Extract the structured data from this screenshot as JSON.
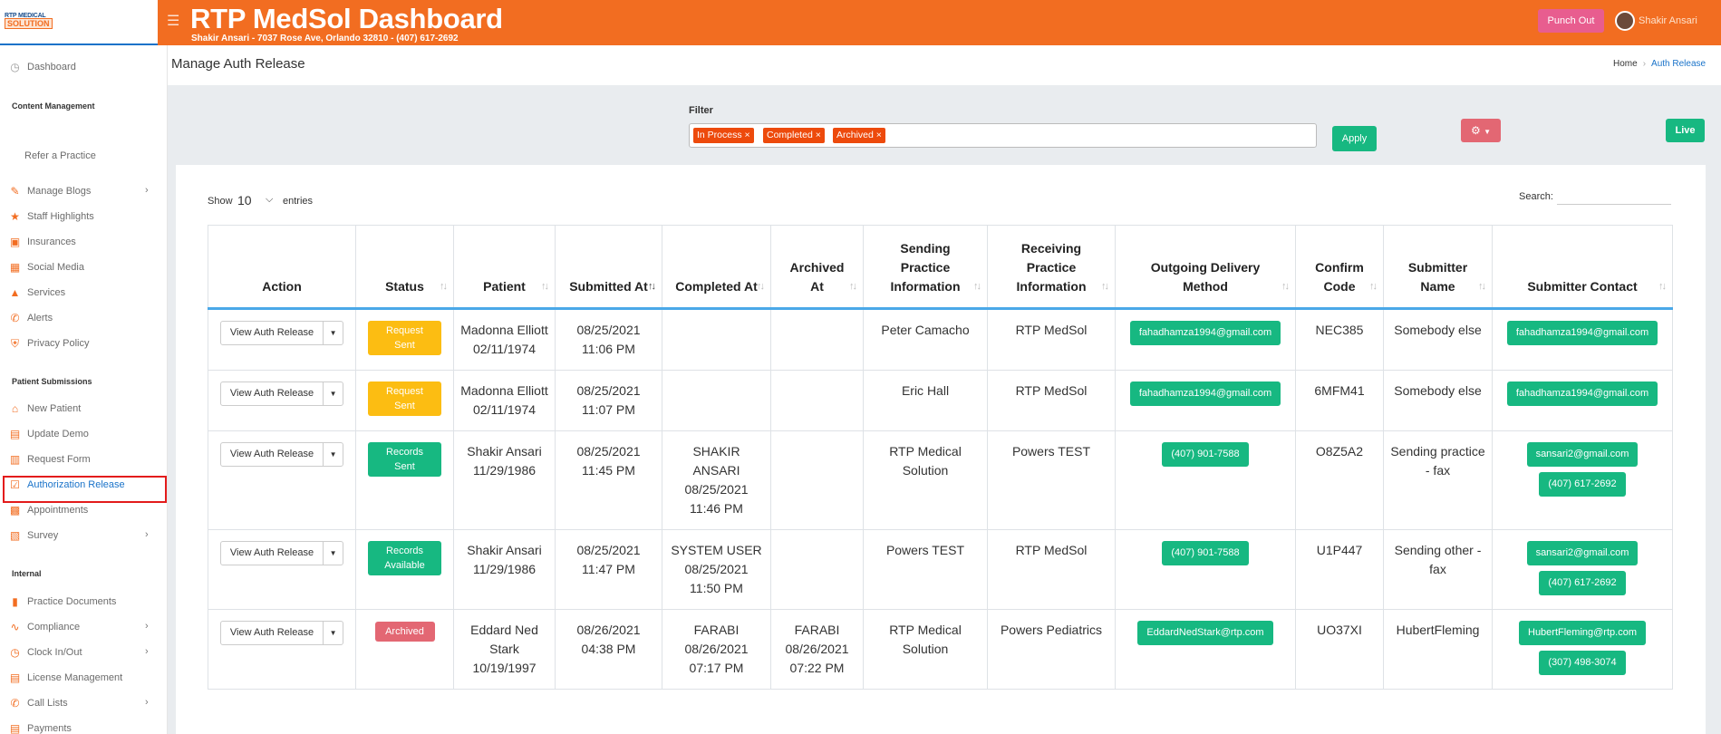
{
  "header": {
    "logo_line1": "RTP MEDICAL",
    "logo_line2": "SOLUTION",
    "title": "RTP MedSol Dashboard",
    "subtitle": "Shakir Ansari - 7037 Rose Ave, Orlando 32810 - (407) 617-2692",
    "punch_out": "Punch Out",
    "user_name": "Shakir Ansari"
  },
  "sidebar": {
    "dashboard": "Dashboard",
    "section_content": "Content Management",
    "refer": "Refer a Practice",
    "manage_blogs": "Manage Blogs",
    "staff_highlights": "Staff Highlights",
    "insurances": "Insurances",
    "social_media": "Social Media",
    "services": "Services",
    "alerts": "Alerts",
    "privacy_policy": "Privacy Policy",
    "section_patient": "Patient Submissions",
    "new_patient": "New Patient",
    "update_demo": "Update Demo",
    "request_form": "Request Form",
    "authorization_release": "Authorization Release",
    "appointments": "Appointments",
    "survey": "Survey",
    "section_internal": "Internal",
    "practice_documents": "Practice Documents",
    "compliance": "Compliance",
    "clock": "Clock In/Out",
    "license_management": "License Management",
    "call_lists": "Call Lists",
    "payments": "Payments"
  },
  "page": {
    "title": "Manage Auth Release",
    "breadcrumb_home": "Home",
    "breadcrumb_current": "Auth Release"
  },
  "filter": {
    "label": "Filter",
    "tags": [
      "In Process ×",
      "Completed ×",
      "Archived ×"
    ],
    "apply": "Apply",
    "live": "Live"
  },
  "table_controls": {
    "show": "Show",
    "entries_value": "10",
    "entries": "entries",
    "search": "Search:"
  },
  "table": {
    "columns": [
      "Action",
      "Status",
      "Patient",
      "Submitted At",
      "Completed At",
      "Archived At",
      "Sending Practice Information",
      "Receiving Practice Information",
      "Outgoing Delivery Method",
      "Confirm Code",
      "Submitter Name",
      "Submitter Contact"
    ],
    "rows": [
      {
        "action": "View Auth Release",
        "status": "Request Sent",
        "patient": "Madonna Elliott 02/11/1974",
        "submitted": "08/25/2021 11:06 PM",
        "completed": "",
        "archived": "",
        "sending": "Peter Camacho",
        "receiving": "RTP MedSol",
        "delivery": "fahadhamza1994@gmail.com",
        "code": "NEC385",
        "submitter": "Somebody else",
        "contact1": "fahadhamza1994@gmail.com",
        "contact2": ""
      },
      {
        "action": "View Auth Release",
        "status": "Request Sent",
        "patient": "Madonna Elliott 02/11/1974",
        "submitted": "08/25/2021 11:07 PM",
        "completed": "",
        "archived": "",
        "sending": "Eric Hall",
        "receiving": "RTP MedSol",
        "delivery": "fahadhamza1994@gmail.com",
        "code": "6MFM41",
        "submitter": "Somebody else",
        "contact1": "fahadhamza1994@gmail.com",
        "contact2": ""
      },
      {
        "action": "View Auth Release",
        "status": "Records Sent",
        "patient": "Shakir Ansari 11/29/1986",
        "submitted": "08/25/2021 11:45 PM",
        "completed": "SHAKIR ANSARI 08/25/2021 11:46 PM",
        "archived": "",
        "sending": "RTP Medical Solution",
        "receiving": "Powers TEST",
        "delivery": "(407) 901-7588",
        "code": "O8Z5A2",
        "submitter": "Sending practice - fax",
        "contact1": "sansari2@gmail.com",
        "contact2": "(407) 617-2692"
      },
      {
        "action": "View Auth Release",
        "status": "Records Available",
        "patient": "Shakir Ansari 11/29/1986",
        "submitted": "08/25/2021 11:47 PM",
        "completed": "SYSTEM USER 08/25/2021 11:50 PM",
        "archived": "",
        "sending": "Powers TEST",
        "receiving": "RTP MedSol",
        "delivery": "(407) 901-7588",
        "code": "U1P447",
        "submitter": "Sending other - fax",
        "contact1": "sansari2@gmail.com",
        "contact2": "(407) 617-2692"
      },
      {
        "action": "View Auth Release",
        "status": "Archived",
        "patient": "Eddard Ned Stark 10/19/1997",
        "submitted": "08/26/2021 04:38 PM",
        "completed": "FARABI 08/26/2021 07:17 PM",
        "archived": "FARABI 08/26/2021 07:22 PM",
        "sending": "RTP Medical Solution",
        "receiving": "Powers Pediatrics",
        "delivery": "EddardNedStark@rtp.com",
        "code": "UO37XI",
        "submitter": "HubertFleming",
        "contact1": "HubertFleming@rtp.com",
        "contact2": "(307) 498-3074"
      }
    ]
  }
}
